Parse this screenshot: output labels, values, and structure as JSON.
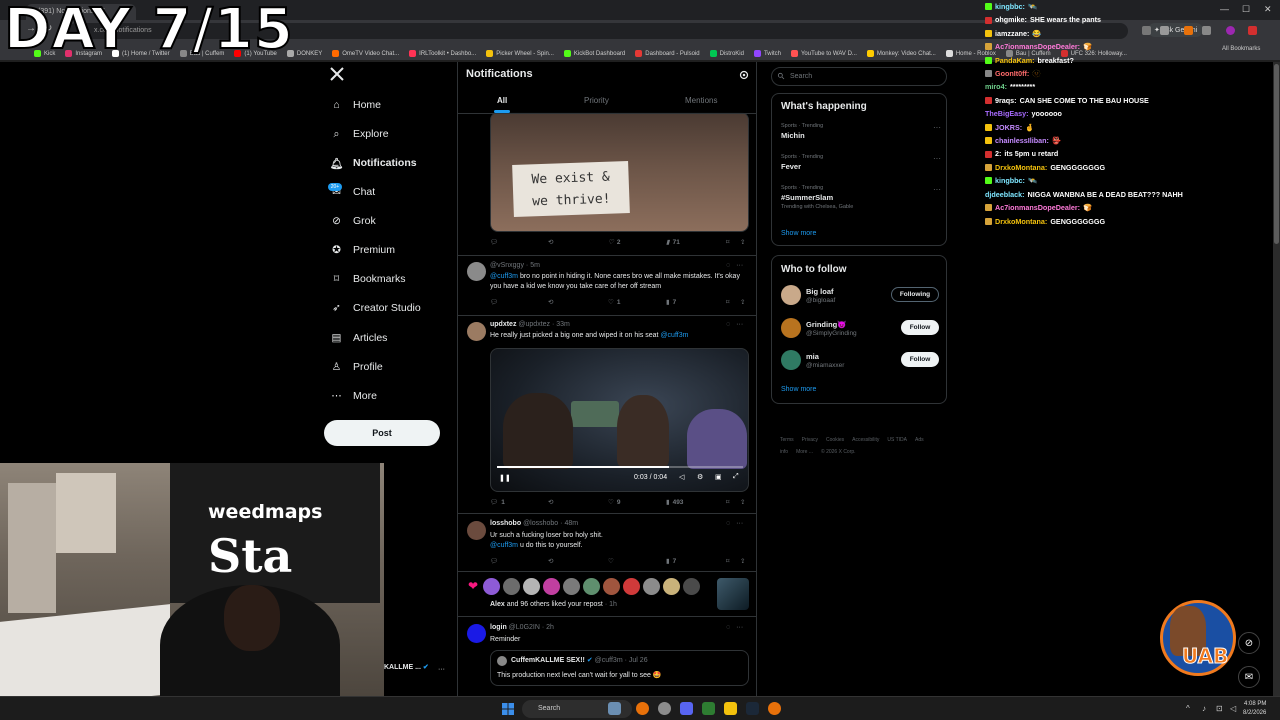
{
  "overlay": {
    "day_counter": "DAY 7/15"
  },
  "browser": {
    "active_tab_title": "(391) Notifications / X",
    "url": "x.com/notifications",
    "ask_gemini": "Ask Gemini",
    "bookmarks": [
      {
        "label": "Kick",
        "color": "#53fc18"
      },
      {
        "label": "Instagram",
        "color": "#e1306c"
      },
      {
        "label": "(1) Home / Twitter",
        "color": "#ffffff"
      },
      {
        "label": "Bau | Cuffem",
        "color": "#888888"
      },
      {
        "label": "(1) YouTube",
        "color": "#ff0000"
      },
      {
        "label": "DONKEY",
        "color": "#aaaaaa"
      },
      {
        "label": "OmeTV Video Chat...",
        "color": "#ff6a00"
      },
      {
        "label": "IRLToolkit • Dashbo...",
        "color": "#ff3355"
      },
      {
        "label": "Picker Wheel - Spin...",
        "color": "#f4c20d"
      },
      {
        "label": "KickBot Dashboard",
        "color": "#53fc18"
      },
      {
        "label": "Dashboard - Pulsoid",
        "color": "#e53935"
      },
      {
        "label": "DistroKid",
        "color": "#00c853"
      },
      {
        "label": "Twitch",
        "color": "#9146ff"
      },
      {
        "label": "YouTube to WAV D...",
        "color": "#ff5252"
      },
      {
        "label": "Monkey: Video Chat...",
        "color": "#ffcc00"
      },
      {
        "label": "Home - Roblox",
        "color": "#dddddd"
      },
      {
        "label": "Bau | Cuffem",
        "color": "#888888"
      },
      {
        "label": "UFC 326: Holloway...",
        "color": "#d32f2f"
      }
    ],
    "all_bookmarks": "All Bookmarks"
  },
  "sidebar": {
    "items": [
      {
        "label": "Home",
        "icon": "home-icon"
      },
      {
        "label": "Explore",
        "icon": "search-icon"
      },
      {
        "label": "Notifications",
        "icon": "bell-icon"
      },
      {
        "label": "Chat",
        "icon": "chat-icon"
      },
      {
        "label": "Grok",
        "icon": "grok-icon"
      },
      {
        "label": "Premium",
        "icon": "premium-icon"
      },
      {
        "label": "Bookmarks",
        "icon": "bookmark-icon"
      },
      {
        "label": "Creator Studio",
        "icon": "rocket-icon"
      },
      {
        "label": "Articles",
        "icon": "article-icon"
      },
      {
        "label": "Profile",
        "icon": "person-icon"
      },
      {
        "label": "More",
        "icon": "more-circle-icon"
      }
    ],
    "chat_badge": "20+",
    "post_label": "Post",
    "account_name": "KALLME ..."
  },
  "main": {
    "title": "Notifications",
    "tabs": [
      "All",
      "Priority",
      "Mentions"
    ],
    "sign_text_1": "We exist &",
    "sign_text_2": "we thrive!",
    "post1_actions": {
      "likes": "2",
      "views": "71"
    },
    "reply1": {
      "handle": "@vSnxggy",
      "time": "5m",
      "mention": "@cuff3m",
      "text": "bro no point in hiding it. None cares bro we all make mistakes. It's okay you have a kid we know you take care of her off stream",
      "likes": "1",
      "views": "7"
    },
    "reply2": {
      "name": "updxtez",
      "handle": "@updxtez",
      "time": "33m",
      "text": "He really just picked a big one and wiped it on his seat",
      "mention": "@cuff3m",
      "video_time": "0:03 / 0:04",
      "video_progress": 0.7,
      "replies": "1",
      "likes": "9",
      "views": "493"
    },
    "reply3": {
      "name": "losshobo",
      "handle": "@losshobo",
      "time": "48m",
      "text1": "Ur such a fucking loser bro holy shit.",
      "mention": "@cuff3m",
      "text2": "u do this to yourself.",
      "views": "7"
    },
    "liked_notice": {
      "bold": "Alex",
      "text": "and 96 others liked your repost",
      "time": "1h"
    },
    "reply4": {
      "name": "login",
      "handle": "@L0G2IN",
      "time": "2h",
      "text": "Reminder",
      "quote_name": "CuffemKALLME SEX!!",
      "quote_handle": "@cuff3m",
      "quote_time": "Jul 26",
      "quote_text": "This production next level can't wait for yall to see 🤩"
    }
  },
  "right": {
    "search_placeholder": "Search",
    "happening_title": "What's happening",
    "trends": [
      {
        "category": "Sports · Trending",
        "name": "Michin",
        "sub": ""
      },
      {
        "category": "Sports · Trending",
        "name": "Fever",
        "sub": ""
      },
      {
        "category": "Sports · Trending",
        "name": "#SummerSlam",
        "sub": "Trending with Chelsea, Gable"
      }
    ],
    "show_more": "Show more",
    "follow_title": "Who to follow",
    "who": [
      {
        "name": "Big loaf",
        "handle": "@bigloaaf",
        "button": "Following",
        "color": "#c9a98a"
      },
      {
        "name": "Grinding😈",
        "handle": "@SimplyGrinding",
        "button": "Follow",
        "color": "#b8731f"
      },
      {
        "name": "mia",
        "handle": "@miamaxxer",
        "button": "Follow",
        "color": "#2f7a63"
      }
    ],
    "footer": [
      "Terms",
      "Privacy",
      "Cookies",
      "Accessibility",
      "US TIDA",
      "Ads info",
      "More ...",
      "© 2026 X Corp."
    ]
  },
  "chat": [
    {
      "user": "kingbbc:",
      "msg": "🛰️",
      "color": "#7ee6ff",
      "badge": "#53fc18"
    },
    {
      "user": "ohgmike:",
      "msg": "SHE wears the pants",
      "color": "#ffffff",
      "badge": "#d32f2f"
    },
    {
      "user": "iamzzane:",
      "msg": "😂",
      "color": "#ffffff",
      "badge": "#f4c20d"
    },
    {
      "user": "Ac7ionmansDopeDealer:",
      "msg": "🍞",
      "color": "#ff7ad9",
      "badge": "#d6a33a"
    },
    {
      "user": "PandaKam:",
      "msg": "breakfast?",
      "color": "#f4c20d",
      "badge": "#53fc18"
    },
    {
      "user": "GoonIt0ff:",
      "msg": "🫥",
      "color": "#ff6b6b",
      "badge": "#888888"
    },
    {
      "user": "miro4:",
      "msg": "*********",
      "color": "#6fd08c",
      "badge": ""
    },
    {
      "user": "9raqs:",
      "msg": "CAN SHE COME TO THE BAU HOUSE",
      "color": "#ffffff",
      "badge": "#d32f2f"
    },
    {
      "user": "TheBigEasy:",
      "msg": "yoooooo",
      "color": "#a86bff",
      "badge": ""
    },
    {
      "user": "JOKRS:",
      "msg": "🤞",
      "color": "#c58bff",
      "badge": "#f4c20d"
    },
    {
      "user": "chainlessIliban:",
      "msg": "👺",
      "color": "#c58bff",
      "badge": "#f4c20d"
    },
    {
      "user": "2:",
      "msg": "its 5pm u retard",
      "color": "#ffffff",
      "badge": "#d32f2f"
    },
    {
      "user": "DrxkoMontana:",
      "msg": "GENGGGGGGG",
      "color": "#f4c20d",
      "badge": "#d6a33a"
    },
    {
      "user": "kingbbc:",
      "msg": "🛰️",
      "color": "#7ee6ff",
      "badge": "#53fc18"
    },
    {
      "user": "djdeeblack:",
      "msg": "NIGGA WANBNA BE A DEAD BEAT??? NAHH",
      "color": "#7ee6ff",
      "badge": ""
    },
    {
      "user": "Ac7ionmansDopeDealer:",
      "msg": "🍞",
      "color": "#ff7ad9",
      "badge": "#d6a33a"
    },
    {
      "user": "DrxkoMontana:",
      "msg": "GENGGGGGGG",
      "color": "#f4c20d",
      "badge": "#d6a33a"
    }
  ],
  "webcam": {
    "banner_brand": "weedmaps",
    "banner_text": "Sta"
  },
  "mascot": {
    "text": "UAB"
  },
  "taskbar": {
    "search_label": "Search",
    "time": "4:08 PM",
    "date": "8/2/2026"
  },
  "colors": {
    "accent": "#1d9bf0",
    "background": "#000000",
    "border": "#2f3336"
  }
}
